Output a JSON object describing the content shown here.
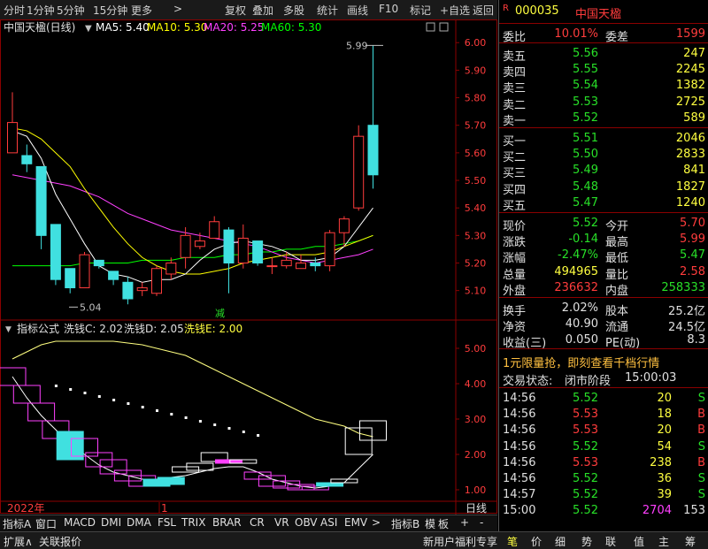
{
  "toolbar": {
    "left_items": [
      "分时",
      "1分钟",
      "5分钟",
      "15分钟",
      "更多"
    ],
    "right_items": [
      "复权",
      "叠加",
      "多股",
      "统计",
      "画线",
      "F10",
      "标记",
      "+自选",
      "返回"
    ]
  },
  "chart_header": {
    "title": "中国天楹(日线)",
    "ma5": "MA5: 5.40",
    "ma10": "MA10: 5.30",
    "ma20": "MA20: 5.25",
    "ma60": "MA60: 5.30",
    "colors": {
      "ma5": "#ffffff",
      "ma10": "#ffff00",
      "ma20": "#ff40ff",
      "ma60": "#00ff00"
    }
  },
  "indicator_header": {
    "title": "指标公式",
    "c": "洗钱C: 2.02",
    "d": "洗钱D: 2.05",
    "e": "洗钱E: 2.00"
  },
  "chart_data": [
    {
      "type": "candlestick",
      "title": "中国天楹(日线)",
      "y_ticks": [
        "6.00",
        "5.90",
        "5.80",
        "5.70",
        "5.60",
        "5.50",
        "5.40",
        "5.30",
        "5.20",
        "5.10"
      ],
      "ylim": [
        5.07,
        6.02
      ],
      "annotations": {
        "high": "5.99",
        "low": "5.04",
        "badge": "减"
      },
      "candles": [
        {
          "o": 5.6,
          "h": 5.82,
          "l": 5.6,
          "c": 5.71
        },
        {
          "o": 5.59,
          "h": 5.63,
          "l": 5.53,
          "c": 5.56
        },
        {
          "o": 5.55,
          "h": 5.55,
          "l": 5.25,
          "c": 5.3
        },
        {
          "o": 5.34,
          "h": 5.34,
          "l": 5.12,
          "c": 5.14
        },
        {
          "o": 5.18,
          "h": 5.18,
          "l": 5.09,
          "c": 5.11
        },
        {
          "o": 5.11,
          "h": 5.24,
          "l": 5.11,
          "c": 5.23
        },
        {
          "o": 5.21,
          "h": 5.21,
          "l": 5.18,
          "c": 5.19
        },
        {
          "o": 5.17,
          "h": 5.17,
          "l": 5.12,
          "c": 5.14
        },
        {
          "o": 5.13,
          "h": 5.15,
          "l": 5.05,
          "c": 5.07
        },
        {
          "o": 5.1,
          "h": 5.13,
          "l": 5.08,
          "c": 5.11
        },
        {
          "o": 5.09,
          "h": 5.19,
          "l": 5.08,
          "c": 5.18
        },
        {
          "o": 5.16,
          "h": 5.22,
          "l": 5.14,
          "c": 5.2
        },
        {
          "o": 5.22,
          "h": 5.33,
          "l": 5.18,
          "c": 5.3
        },
        {
          "o": 5.26,
          "h": 5.31,
          "l": 5.25,
          "c": 5.28
        },
        {
          "o": 5.29,
          "h": 5.37,
          "l": 5.29,
          "c": 5.35
        },
        {
          "o": 5.32,
          "h": 5.33,
          "l": 5.09,
          "c": 5.2
        },
        {
          "o": 5.2,
          "h": 5.34,
          "l": 5.18,
          "c": 5.29
        },
        {
          "o": 5.28,
          "h": 5.28,
          "l": 5.19,
          "c": 5.2
        },
        {
          "o": 5.19,
          "h": 5.22,
          "l": 5.16,
          "c": 5.19
        },
        {
          "o": 5.19,
          "h": 5.24,
          "l": 5.18,
          "c": 5.21
        },
        {
          "o": 5.18,
          "h": 5.23,
          "l": 5.18,
          "c": 5.2
        },
        {
          "o": 5.2,
          "h": 5.22,
          "l": 5.17,
          "c": 5.19
        },
        {
          "o": 5.19,
          "h": 5.32,
          "l": 5.17,
          "c": 5.31
        },
        {
          "o": 5.31,
          "h": 5.37,
          "l": 5.26,
          "c": 5.36
        },
        {
          "o": 5.4,
          "h": 5.7,
          "l": 5.39,
          "c": 5.66
        },
        {
          "o": 5.7,
          "h": 5.99,
          "l": 5.47,
          "c": 5.52
        }
      ],
      "ma5": [
        5.68,
        5.66,
        5.58,
        5.45,
        5.36,
        5.27,
        5.19,
        5.16,
        5.15,
        5.13,
        5.14,
        5.14,
        5.16,
        5.21,
        5.25,
        5.27,
        5.28,
        5.27,
        5.26,
        5.24,
        5.21,
        5.21,
        5.22,
        5.26,
        5.33,
        5.4
      ],
      "ma10": [
        5.69,
        5.68,
        5.65,
        5.6,
        5.55,
        5.47,
        5.4,
        5.33,
        5.27,
        5.22,
        5.19,
        5.17,
        5.16,
        5.16,
        5.17,
        5.18,
        5.2,
        5.21,
        5.22,
        5.23,
        5.23,
        5.23,
        5.24,
        5.26,
        5.28,
        5.3
      ],
      "ma20": [
        5.52,
        5.51,
        5.5,
        5.49,
        5.48,
        5.46,
        5.44,
        5.41,
        5.38,
        5.36,
        5.34,
        5.32,
        5.31,
        5.3,
        5.29,
        5.28,
        5.27,
        5.26,
        5.24,
        5.22,
        5.21,
        5.2,
        5.21,
        5.22,
        5.23,
        5.25
      ],
      "ma60": [
        5.19,
        5.19,
        5.19,
        5.19,
        5.19,
        5.2,
        5.2,
        5.2,
        5.2,
        5.21,
        5.21,
        5.21,
        5.22,
        5.22,
        5.22,
        5.23,
        5.23,
        5.24,
        5.24,
        5.25,
        5.25,
        5.26,
        5.26,
        5.27,
        5.28,
        5.3
      ]
    },
    {
      "type": "indicator",
      "title": "指标公式",
      "y_ticks": [
        "5.00",
        "4.00",
        "3.00",
        "2.00",
        "1.00"
      ],
      "ylim": [
        0.8,
        5.3
      ],
      "boxes": [
        {
          "x": 0,
          "lo": 3.95,
          "hi": 4.45,
          "color": "#ff40ff"
        },
        {
          "x": 1,
          "lo": 3.45,
          "hi": 3.95,
          "color": "#ff40ff"
        },
        {
          "x": 2,
          "lo": 2.95,
          "hi": 3.45,
          "color": "#ff40ff"
        },
        {
          "x": 3,
          "lo": 2.45,
          "hi": 2.95,
          "color": "#ff40ff"
        },
        {
          "x": 4,
          "lo": 1.85,
          "hi": 2.65,
          "color": "#40e0e0",
          "fill": true
        },
        {
          "x": 5,
          "lo": 1.95,
          "hi": 2.45,
          "color": "#ff40ff"
        },
        {
          "x": 6,
          "lo": 1.65,
          "hi": 2.05,
          "color": "#ff40ff"
        },
        {
          "x": 7,
          "lo": 1.45,
          "hi": 1.85,
          "color": "#ff40ff"
        },
        {
          "x": 8,
          "lo": 1.25,
          "hi": 1.55,
          "color": "#ff40ff"
        },
        {
          "x": 9,
          "lo": 1.1,
          "hi": 1.4,
          "color": "#ff40ff"
        },
        {
          "x": 10,
          "lo": 1.1,
          "hi": 1.3,
          "color": "#40e0e0",
          "fill": true
        },
        {
          "x": 11,
          "lo": 1.15,
          "hi": 1.35,
          "color": "#40e0e0",
          "fill": true
        },
        {
          "x": 12,
          "lo": 1.5,
          "hi": 1.65,
          "color": "#ffffff"
        },
        {
          "x": 13,
          "lo": 1.55,
          "hi": 1.75,
          "color": "#ffffff"
        },
        {
          "x": 14,
          "lo": 1.8,
          "hi": 2.05,
          "color": "#ffffff"
        },
        {
          "x": 15,
          "lo": 1.75,
          "hi": 1.85,
          "color": "#ff40ff",
          "fill": true
        },
        {
          "x": 16,
          "lo": 1.75,
          "hi": 1.85,
          "color": "#ffffff"
        },
        {
          "x": 17,
          "lo": 1.3,
          "hi": 1.5,
          "color": "#ff40ff"
        },
        {
          "x": 18,
          "lo": 1.1,
          "hi": 1.4,
          "color": "#ff40ff"
        },
        {
          "x": 19,
          "lo": 1.05,
          "hi": 1.25,
          "color": "#ff40ff"
        },
        {
          "x": 20,
          "lo": 1.0,
          "hi": 1.15,
          "color": "#ff40ff"
        },
        {
          "x": 21,
          "lo": 1.0,
          "hi": 1.1,
          "color": "#ff40ff"
        },
        {
          "x": 22,
          "lo": 1.1,
          "hi": 1.2,
          "color": "#40e0e0",
          "fill": true
        },
        {
          "x": 23,
          "lo": 1.2,
          "hi": 1.3,
          "color": "#ffffff"
        },
        {
          "x": 24,
          "lo": 2.0,
          "hi": 2.75,
          "color": "#ffffff"
        },
        {
          "x": 25,
          "lo": 2.4,
          "hi": 2.95,
          "color": "#ffffff"
        }
      ],
      "line_c": [
        4.7,
        4.9,
        5.1,
        5.2,
        5.2,
        5.2,
        5.2,
        5.2,
        5.15,
        5.1,
        5.0,
        4.9,
        4.8,
        4.6,
        4.4,
        4.2,
        4.0,
        3.8,
        3.6,
        3.4,
        3.2,
        3.0,
        2.9,
        2.8,
        2.6,
        2.5
      ],
      "line_c_color": "#ffff80",
      "line_w": [
        4.2,
        3.6,
        3.1,
        2.7,
        2.3,
        2.0,
        1.7,
        1.5,
        1.4,
        1.3,
        1.3,
        1.35,
        1.4,
        1.5,
        1.6,
        1.65,
        1.65,
        1.5,
        1.3,
        1.2,
        1.1,
        1.05,
        1.1,
        1.2,
        1.6,
        2.0
      ],
      "dots": [
        3.95,
        3.85,
        3.75,
        3.65,
        3.55,
        3.45,
        3.35,
        3.25,
        3.15,
        3.05,
        2.95,
        2.85,
        2.75,
        2.65,
        2.55
      ],
      "dots_start": 3
    }
  ],
  "xaxis": {
    "year_label": "2022年",
    "month_label": "1",
    "period": "日线"
  },
  "bottom_tabs": [
    "指标A",
    "窗口",
    "MACD",
    "DMI",
    "DMA",
    "FSL",
    "TRIX",
    "BRAR",
    "CR",
    "VR",
    "OBV",
    "ASI",
    "EMV",
    ">",
    "指标B",
    "模",
    "板",
    "+",
    "-"
  ],
  "status_bar": {
    "left_items": [
      "扩展∧",
      "关联报价"
    ],
    "right_items": [
      "新用户福利专享",
      "笔",
      "价",
      "细",
      "势",
      "联",
      "值",
      "主",
      "筹"
    ]
  },
  "quote": {
    "logo": "R",
    "code": "000035",
    "name": "中国天楹",
    "weibi_label": "委比",
    "weibi": "10.01%",
    "weicha_label": "委差",
    "weicha": "1599",
    "sell": [
      {
        "label": "卖五",
        "price": "5.56",
        "vol": "247"
      },
      {
        "label": "卖四",
        "price": "5.55",
        "vol": "2245"
      },
      {
        "label": "卖三",
        "price": "5.54",
        "vol": "1382"
      },
      {
        "label": "卖二",
        "price": "5.53",
        "vol": "2725"
      },
      {
        "label": "卖一",
        "price": "5.52",
        "vol": "589"
      }
    ],
    "buy": [
      {
        "label": "买一",
        "price": "5.51",
        "vol": "2046"
      },
      {
        "label": "买二",
        "price": "5.50",
        "vol": "2833"
      },
      {
        "label": "买三",
        "price": "5.49",
        "vol": "841"
      },
      {
        "label": "买四",
        "price": "5.48",
        "vol": "1827"
      },
      {
        "label": "买五",
        "price": "5.47",
        "vol": "1240"
      }
    ],
    "stats": [
      {
        "l1": "现价",
        "v1": "5.52",
        "c1": "c-green",
        "l2": "今开",
        "v2": "5.70",
        "c2": "c-red"
      },
      {
        "l1": "涨跌",
        "v1": "-0.14",
        "c1": "c-green",
        "l2": "最高",
        "v2": "5.99",
        "c2": "c-red"
      },
      {
        "l1": "涨幅",
        "v1": "-2.47%",
        "c1": "c-green",
        "l2": "最低",
        "v2": "5.47",
        "c2": "c-green"
      },
      {
        "l1": "总量",
        "v1": "494965",
        "c1": "c-yellow",
        "l2": "量比",
        "v2": "2.58",
        "c2": "c-red"
      },
      {
        "l1": "外盘",
        "v1": "236632",
        "c1": "c-red",
        "l2": "内盘",
        "v2": "258333",
        "c2": "c-green"
      }
    ],
    "stats2": [
      {
        "l1": "换手",
        "v1": "2.02%",
        "l2": "股本",
        "v2": "25.2亿"
      },
      {
        "l1": "净资",
        "v1": "40.90",
        "l2": "流通",
        "v2": "24.5亿"
      },
      {
        "l1": "收益(三)",
        "v1": "0.050",
        "l2": "PE(动)",
        "v2": "8.3"
      }
    ],
    "promo": "1元限量抢，即刻查看千档行情",
    "trade_status_label": "交易状态:",
    "trade_status": "闭市阶段",
    "trade_time": "15:00:03",
    "ticks": [
      {
        "t": "14:56",
        "p": "5.52",
        "v": "20",
        "s": "S"
      },
      {
        "t": "14:56",
        "p": "5.53",
        "v": "18",
        "s": "B"
      },
      {
        "t": "14:56",
        "p": "5.53",
        "v": "20",
        "s": "B"
      },
      {
        "t": "14:56",
        "p": "5.52",
        "v": "54",
        "s": "S"
      },
      {
        "t": "14:56",
        "p": "5.53",
        "v": "238",
        "s": "B"
      },
      {
        "t": "14:56",
        "p": "5.52",
        "v": "36",
        "s": "S"
      },
      {
        "t": "14:57",
        "p": "5.52",
        "v": "39",
        "s": "S"
      },
      {
        "t": "15:00",
        "p": "5.52",
        "v": "2704",
        "s": "153"
      }
    ]
  }
}
